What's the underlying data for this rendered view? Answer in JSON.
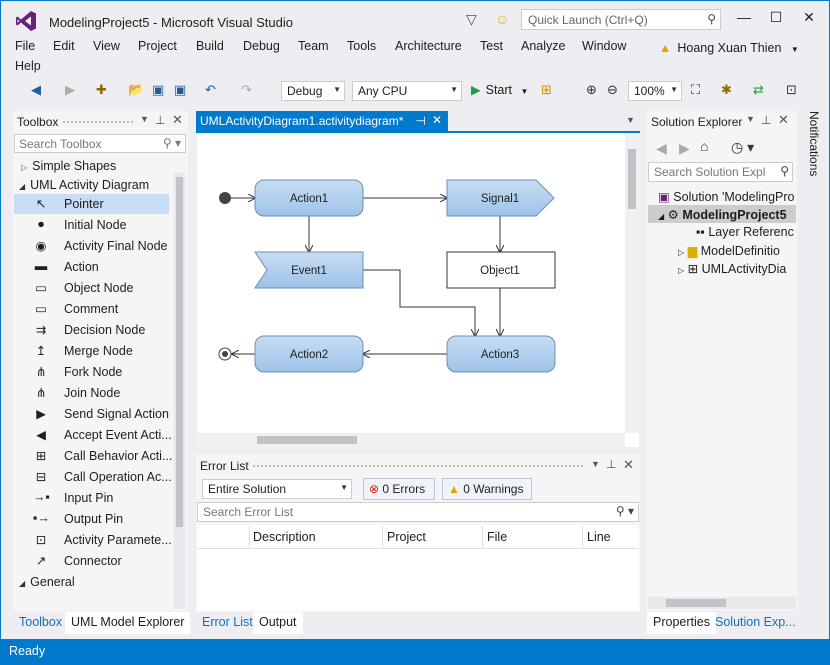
{
  "window": {
    "title": "ModelingProject5 - Microsoft Visual Studio",
    "quick_launch_placeholder": "Quick Launch (Ctrl+Q)",
    "accent": "#007acc"
  },
  "menu": {
    "items": [
      "File",
      "Edit",
      "View",
      "Project",
      "Build",
      "Debug",
      "Team",
      "Tools",
      "Architecture",
      "Test",
      "Analyze",
      "Window",
      "Help"
    ],
    "user": "Hoang Xuan Thien"
  },
  "toolbar": {
    "config": "Debug",
    "platform": "Any CPU",
    "start_label": "Start",
    "zoom": "100%"
  },
  "toolbox": {
    "title": "Toolbox",
    "search_placeholder": "Search Toolbox",
    "group_simple": "Simple Shapes",
    "group_uml": "UML Activity Diagram",
    "tools": [
      {
        "label": "Pointer",
        "icon": "pointer-icon",
        "glyph": "↖"
      },
      {
        "label": "Initial Node",
        "icon": "initial-node-icon",
        "glyph": "●"
      },
      {
        "label": "Activity Final Node",
        "icon": "final-node-icon",
        "glyph": "◉"
      },
      {
        "label": "Action",
        "icon": "action-icon",
        "glyph": "▬"
      },
      {
        "label": "Object Node",
        "icon": "object-node-icon",
        "glyph": "▭"
      },
      {
        "label": "Comment",
        "icon": "comment-icon",
        "glyph": "▭"
      },
      {
        "label": "Decision Node",
        "icon": "decision-node-icon",
        "glyph": "⇉"
      },
      {
        "label": "Merge Node",
        "icon": "merge-node-icon",
        "glyph": "↥"
      },
      {
        "label": "Fork Node",
        "icon": "fork-node-icon",
        "glyph": "⋔"
      },
      {
        "label": "Join Node",
        "icon": "join-node-icon",
        "glyph": "⋔"
      },
      {
        "label": "Send Signal Action",
        "icon": "send-signal-icon",
        "glyph": "▶"
      },
      {
        "label": "Accept Event Acti...",
        "icon": "accept-event-icon",
        "glyph": "◀"
      },
      {
        "label": "Call Behavior Acti...",
        "icon": "call-behavior-icon",
        "glyph": "⊞"
      },
      {
        "label": "Call Operation Ac...",
        "icon": "call-operation-icon",
        "glyph": "⊟"
      },
      {
        "label": "Input Pin",
        "icon": "input-pin-icon",
        "glyph": "→▪"
      },
      {
        "label": "Output Pin",
        "icon": "output-pin-icon",
        "glyph": "▪→"
      },
      {
        "label": "Activity Paramete...",
        "icon": "activity-parameter-icon",
        "glyph": "⊡"
      },
      {
        "label": "Connector",
        "icon": "connector-icon",
        "glyph": "↗"
      }
    ],
    "group_general": "General",
    "tab_toolbox": "Toolbox",
    "tab_uml_explorer": "UML Model Explorer"
  },
  "document": {
    "tab": "UMLActivityDiagram1.activitydiagram*",
    "nodes": {
      "action1": "Action1",
      "signal1": "Signal1",
      "event1": "Event1",
      "object1": "Object1",
      "action2": "Action2",
      "action3": "Action3"
    }
  },
  "error_list": {
    "title": "Error List",
    "scope": "Entire Solution",
    "errors": "0 Errors",
    "warnings": "0 Warnings",
    "search_placeholder": "Search Error List",
    "columns": [
      "Description",
      "Project",
      "File",
      "Line"
    ],
    "tab_errors": "Error List",
    "tab_output": "Output"
  },
  "solution_explorer": {
    "title": "Solution Explorer",
    "search_placeholder": "Search Solution Expl",
    "items": [
      "Solution 'ModelingPro",
      "ModelingProject5",
      "Layer Referenc",
      "ModelDefinitio",
      "UMLActivityDia"
    ],
    "tab_properties": "Properties",
    "tab_solution": "Solution Exp..."
  },
  "notifications": "Notifications",
  "status": "Ready"
}
